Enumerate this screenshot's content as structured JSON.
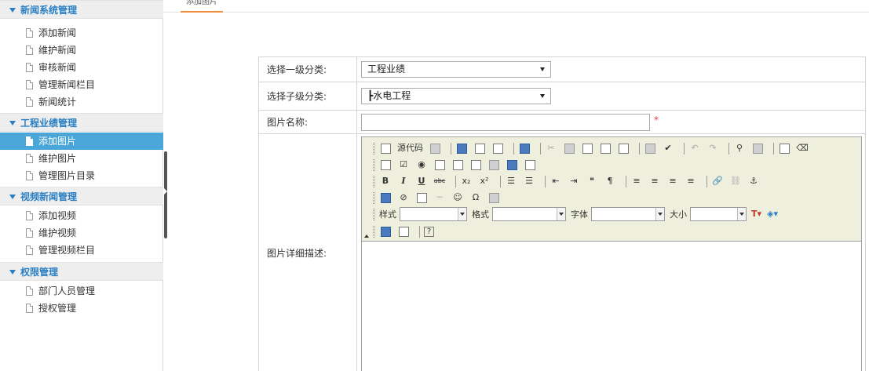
{
  "sidebar": {
    "groups": [
      {
        "title": "新闻系统管理",
        "items": [
          "添加新闻",
          "维护新闻",
          "审核新闻",
          "管理新闻栏目",
          "新闻统计"
        ]
      },
      {
        "title": "工程业绩管理",
        "items": [
          "添加图片",
          "维护图片",
          "管理图片目录"
        ],
        "active_item": "添加图片"
      },
      {
        "title": "视频新闻管理",
        "items": [
          "添加视频",
          "维护视频",
          "管理视频栏目"
        ]
      },
      {
        "title": "权限管理",
        "items": [
          "部门人员管理",
          "授权管理"
        ]
      }
    ]
  },
  "tab": {
    "label": "添加图片"
  },
  "form": {
    "category_label": "选择一级分类:",
    "category_value": "工程业绩",
    "subcategory_label": "选择子级分类:",
    "subcategory_value": "┣水电工程",
    "name_label": "图片名称:",
    "name_value": "",
    "required_mark": "*",
    "desc_label": "图片详细描述:"
  },
  "editor": {
    "source_label": "源代码",
    "style_label": "样式",
    "format_label": "格式",
    "font_label": "字体",
    "size_label": "大小",
    "bold": "B",
    "italic": "I",
    "underline": "U",
    "help": "?"
  },
  "colors": {
    "accent": "#4aa5d8",
    "group_title": "#2a7fc4",
    "tab_underline": "#f08c3a",
    "toolbar_bg": "#efefde",
    "required": "#e03c3c"
  }
}
